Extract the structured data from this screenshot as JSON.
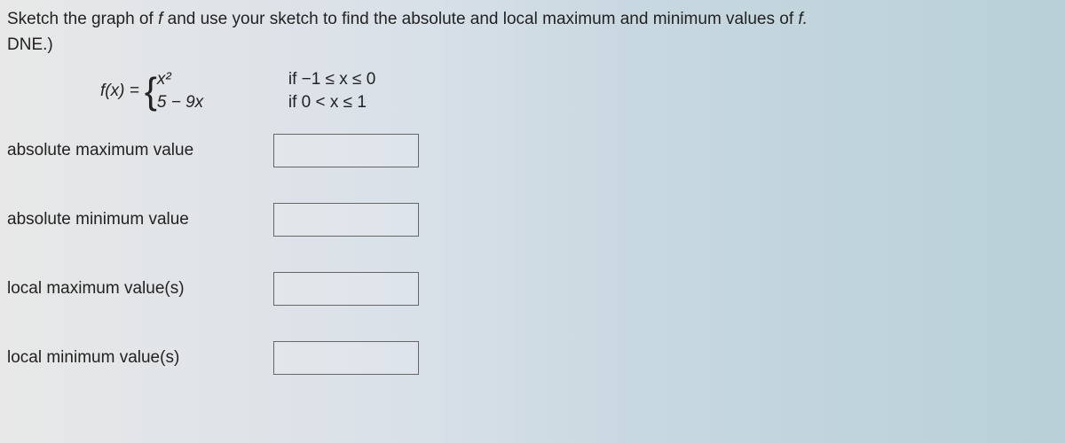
{
  "instruction_part1": "Sketch the graph of ",
  "instruction_fvar": "f ",
  "instruction_part2": "and use your sketch to find the absolute and local maximum and minimum values of ",
  "instruction_fvar2": "f.",
  "instruction_dne": "DNE.)",
  "function": {
    "lhs": "f(x) = ",
    "pieces": [
      {
        "expr": "x²",
        "cond": "if −1 ≤ x ≤ 0"
      },
      {
        "expr": "5 − 9x",
        "cond": "if 0 < x ≤ 1"
      }
    ]
  },
  "answers": [
    {
      "label": "absolute maximum value",
      "value": ""
    },
    {
      "label": "absolute minimum value",
      "value": ""
    },
    {
      "label": "local maximum value(s)",
      "value": ""
    },
    {
      "label": "local minimum value(s)",
      "value": ""
    }
  ]
}
